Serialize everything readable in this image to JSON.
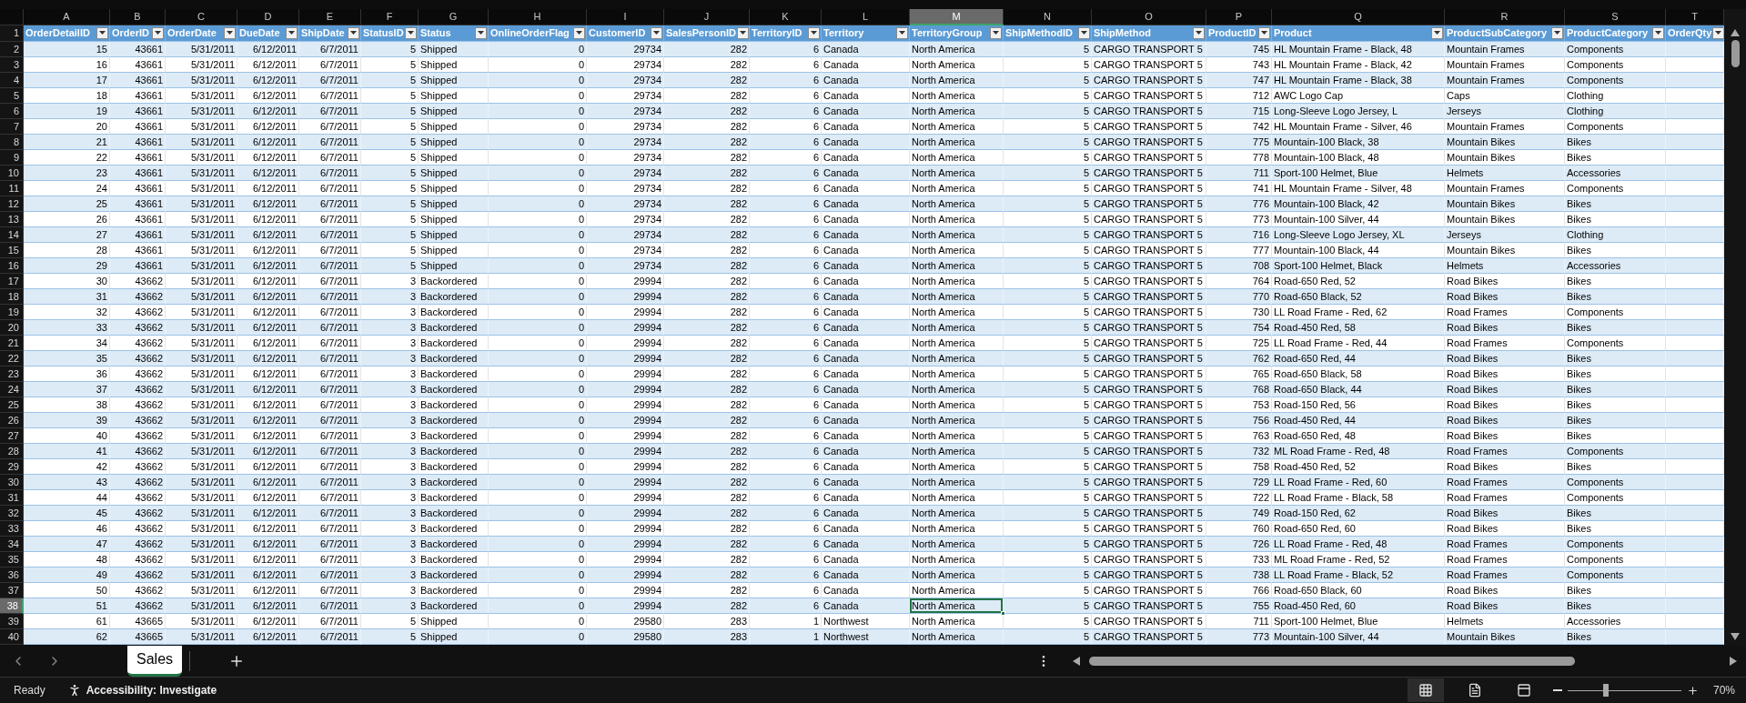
{
  "sheet": {
    "header_row_number": "1",
    "columns": [
      {
        "letter": "A",
        "header": "OrderDetailID",
        "kind": "number",
        "selected": false
      },
      {
        "letter": "B",
        "header": "OrderID",
        "kind": "number",
        "selected": false
      },
      {
        "letter": "C",
        "header": "OrderDate",
        "kind": "number",
        "selected": false
      },
      {
        "letter": "D",
        "header": "DueDate",
        "kind": "number",
        "selected": false
      },
      {
        "letter": "E",
        "header": "ShipDate",
        "kind": "number",
        "selected": false
      },
      {
        "letter": "F",
        "header": "StatusID",
        "kind": "number",
        "selected": false
      },
      {
        "letter": "G",
        "header": "Status",
        "kind": "text",
        "selected": false
      },
      {
        "letter": "H",
        "header": "OnlineOrderFlag",
        "kind": "number",
        "selected": false
      },
      {
        "letter": "I",
        "header": "CustomerID",
        "kind": "number",
        "selected": false
      },
      {
        "letter": "J",
        "header": "SalesPersonID",
        "kind": "number",
        "selected": false
      },
      {
        "letter": "K",
        "header": "TerritoryID",
        "kind": "number",
        "selected": false
      },
      {
        "letter": "L",
        "header": "Territory",
        "kind": "text",
        "selected": false
      },
      {
        "letter": "M",
        "header": "TerritoryGroup",
        "kind": "text",
        "selected": true
      },
      {
        "letter": "N",
        "header": "ShipMethodID",
        "kind": "number",
        "selected": false
      },
      {
        "letter": "O",
        "header": "ShipMethod",
        "kind": "text",
        "selected": false
      },
      {
        "letter": "P",
        "header": "ProductID",
        "kind": "number",
        "selected": false
      },
      {
        "letter": "Q",
        "header": "Product",
        "kind": "text",
        "selected": false
      },
      {
        "letter": "R",
        "header": "ProductSubCategory",
        "kind": "text",
        "selected": false
      },
      {
        "letter": "S",
        "header": "ProductCategory",
        "kind": "text",
        "selected": false
      },
      {
        "letter": "T",
        "header": "OrderQty",
        "kind": "number",
        "selected": false
      }
    ],
    "rows": [
      {
        "number": "2",
        "selected": false,
        "cells": [
          "15",
          "43661",
          "5/31/2011",
          "6/12/2011",
          "6/7/2011",
          "5",
          "Shipped",
          "0",
          "29734",
          "282",
          "6",
          "Canada",
          "North America",
          "5",
          "CARGO TRANSPORT 5",
          "745",
          "HL Mountain Frame - Black, 48",
          "Mountain Frames",
          "Components"
        ]
      },
      {
        "number": "3",
        "selected": false,
        "cells": [
          "16",
          "43661",
          "5/31/2011",
          "6/12/2011",
          "6/7/2011",
          "5",
          "Shipped",
          "0",
          "29734",
          "282",
          "6",
          "Canada",
          "North America",
          "5",
          "CARGO TRANSPORT 5",
          "743",
          "HL Mountain Frame - Black, 42",
          "Mountain Frames",
          "Components"
        ]
      },
      {
        "number": "4",
        "selected": false,
        "cells": [
          "17",
          "43661",
          "5/31/2011",
          "6/12/2011",
          "6/7/2011",
          "5",
          "Shipped",
          "0",
          "29734",
          "282",
          "6",
          "Canada",
          "North America",
          "5",
          "CARGO TRANSPORT 5",
          "747",
          "HL Mountain Frame - Black, 38",
          "Mountain Frames",
          "Components"
        ]
      },
      {
        "number": "5",
        "selected": false,
        "cells": [
          "18",
          "43661",
          "5/31/2011",
          "6/12/2011",
          "6/7/2011",
          "5",
          "Shipped",
          "0",
          "29734",
          "282",
          "6",
          "Canada",
          "North America",
          "5",
          "CARGO TRANSPORT 5",
          "712",
          "AWC Logo Cap",
          "Caps",
          "Clothing"
        ]
      },
      {
        "number": "6",
        "selected": false,
        "cells": [
          "19",
          "43661",
          "5/31/2011",
          "6/12/2011",
          "6/7/2011",
          "5",
          "Shipped",
          "0",
          "29734",
          "282",
          "6",
          "Canada",
          "North America",
          "5",
          "CARGO TRANSPORT 5",
          "715",
          "Long-Sleeve Logo Jersey, L",
          "Jerseys",
          "Clothing"
        ]
      },
      {
        "number": "7",
        "selected": false,
        "cells": [
          "20",
          "43661",
          "5/31/2011",
          "6/12/2011",
          "6/7/2011",
          "5",
          "Shipped",
          "0",
          "29734",
          "282",
          "6",
          "Canada",
          "North America",
          "5",
          "CARGO TRANSPORT 5",
          "742",
          "HL Mountain Frame - Silver, 46",
          "Mountain Frames",
          "Components"
        ]
      },
      {
        "number": "8",
        "selected": false,
        "cells": [
          "21",
          "43661",
          "5/31/2011",
          "6/12/2011",
          "6/7/2011",
          "5",
          "Shipped",
          "0",
          "29734",
          "282",
          "6",
          "Canada",
          "North America",
          "5",
          "CARGO TRANSPORT 5",
          "775",
          "Mountain-100 Black, 38",
          "Mountain Bikes",
          "Bikes"
        ]
      },
      {
        "number": "9",
        "selected": false,
        "cells": [
          "22",
          "43661",
          "5/31/2011",
          "6/12/2011",
          "6/7/2011",
          "5",
          "Shipped",
          "0",
          "29734",
          "282",
          "6",
          "Canada",
          "North America",
          "5",
          "CARGO TRANSPORT 5",
          "778",
          "Mountain-100 Black, 48",
          "Mountain Bikes",
          "Bikes"
        ]
      },
      {
        "number": "10",
        "selected": false,
        "cells": [
          "23",
          "43661",
          "5/31/2011",
          "6/12/2011",
          "6/7/2011",
          "5",
          "Shipped",
          "0",
          "29734",
          "282",
          "6",
          "Canada",
          "North America",
          "5",
          "CARGO TRANSPORT 5",
          "711",
          "Sport-100 Helmet, Blue",
          "Helmets",
          "Accessories"
        ]
      },
      {
        "number": "11",
        "selected": false,
        "cells": [
          "24",
          "43661",
          "5/31/2011",
          "6/12/2011",
          "6/7/2011",
          "5",
          "Shipped",
          "0",
          "29734",
          "282",
          "6",
          "Canada",
          "North America",
          "5",
          "CARGO TRANSPORT 5",
          "741",
          "HL Mountain Frame - Silver, 48",
          "Mountain Frames",
          "Components"
        ]
      },
      {
        "number": "12",
        "selected": false,
        "cells": [
          "25",
          "43661",
          "5/31/2011",
          "6/12/2011",
          "6/7/2011",
          "5",
          "Shipped",
          "0",
          "29734",
          "282",
          "6",
          "Canada",
          "North America",
          "5",
          "CARGO TRANSPORT 5",
          "776",
          "Mountain-100 Black, 42",
          "Mountain Bikes",
          "Bikes"
        ]
      },
      {
        "number": "13",
        "selected": false,
        "cells": [
          "26",
          "43661",
          "5/31/2011",
          "6/12/2011",
          "6/7/2011",
          "5",
          "Shipped",
          "0",
          "29734",
          "282",
          "6",
          "Canada",
          "North America",
          "5",
          "CARGO TRANSPORT 5",
          "773",
          "Mountain-100 Silver, 44",
          "Mountain Bikes",
          "Bikes"
        ]
      },
      {
        "number": "14",
        "selected": false,
        "cells": [
          "27",
          "43661",
          "5/31/2011",
          "6/12/2011",
          "6/7/2011",
          "5",
          "Shipped",
          "0",
          "29734",
          "282",
          "6",
          "Canada",
          "North America",
          "5",
          "CARGO TRANSPORT 5",
          "716",
          "Long-Sleeve Logo Jersey, XL",
          "Jerseys",
          "Clothing"
        ]
      },
      {
        "number": "15",
        "selected": false,
        "cells": [
          "28",
          "43661",
          "5/31/2011",
          "6/12/2011",
          "6/7/2011",
          "5",
          "Shipped",
          "0",
          "29734",
          "282",
          "6",
          "Canada",
          "North America",
          "5",
          "CARGO TRANSPORT 5",
          "777",
          "Mountain-100 Black, 44",
          "Mountain Bikes",
          "Bikes"
        ]
      },
      {
        "number": "16",
        "selected": false,
        "cells": [
          "29",
          "43661",
          "5/31/2011",
          "6/12/2011",
          "6/7/2011",
          "5",
          "Shipped",
          "0",
          "29734",
          "282",
          "6",
          "Canada",
          "North America",
          "5",
          "CARGO TRANSPORT 5",
          "708",
          "Sport-100 Helmet, Black",
          "Helmets",
          "Accessories"
        ]
      },
      {
        "number": "17",
        "selected": false,
        "cells": [
          "30",
          "43662",
          "5/31/2011",
          "6/12/2011",
          "6/7/2011",
          "3",
          "Backordered",
          "0",
          "29994",
          "282",
          "6",
          "Canada",
          "North America",
          "5",
          "CARGO TRANSPORT 5",
          "764",
          "Road-650 Red, 52",
          "Road Bikes",
          "Bikes"
        ]
      },
      {
        "number": "18",
        "selected": false,
        "cells": [
          "31",
          "43662",
          "5/31/2011",
          "6/12/2011",
          "6/7/2011",
          "3",
          "Backordered",
          "0",
          "29994",
          "282",
          "6",
          "Canada",
          "North America",
          "5",
          "CARGO TRANSPORT 5",
          "770",
          "Road-650 Black, 52",
          "Road Bikes",
          "Bikes"
        ]
      },
      {
        "number": "19",
        "selected": false,
        "cells": [
          "32",
          "43662",
          "5/31/2011",
          "6/12/2011",
          "6/7/2011",
          "3",
          "Backordered",
          "0",
          "29994",
          "282",
          "6",
          "Canada",
          "North America",
          "5",
          "CARGO TRANSPORT 5",
          "730",
          "LL Road Frame - Red, 62",
          "Road Frames",
          "Components"
        ]
      },
      {
        "number": "20",
        "selected": false,
        "cells": [
          "33",
          "43662",
          "5/31/2011",
          "6/12/2011",
          "6/7/2011",
          "3",
          "Backordered",
          "0",
          "29994",
          "282",
          "6",
          "Canada",
          "North America",
          "5",
          "CARGO TRANSPORT 5",
          "754",
          "Road-450 Red, 58",
          "Road Bikes",
          "Bikes"
        ]
      },
      {
        "number": "21",
        "selected": false,
        "cells": [
          "34",
          "43662",
          "5/31/2011",
          "6/12/2011",
          "6/7/2011",
          "3",
          "Backordered",
          "0",
          "29994",
          "282",
          "6",
          "Canada",
          "North America",
          "5",
          "CARGO TRANSPORT 5",
          "725",
          "LL Road Frame - Red, 44",
          "Road Frames",
          "Components"
        ]
      },
      {
        "number": "22",
        "selected": false,
        "cells": [
          "35",
          "43662",
          "5/31/2011",
          "6/12/2011",
          "6/7/2011",
          "3",
          "Backordered",
          "0",
          "29994",
          "282",
          "6",
          "Canada",
          "North America",
          "5",
          "CARGO TRANSPORT 5",
          "762",
          "Road-650 Red, 44",
          "Road Bikes",
          "Bikes"
        ]
      },
      {
        "number": "23",
        "selected": false,
        "cells": [
          "36",
          "43662",
          "5/31/2011",
          "6/12/2011",
          "6/7/2011",
          "3",
          "Backordered",
          "0",
          "29994",
          "282",
          "6",
          "Canada",
          "North America",
          "5",
          "CARGO TRANSPORT 5",
          "765",
          "Road-650 Black, 58",
          "Road Bikes",
          "Bikes"
        ]
      },
      {
        "number": "24",
        "selected": false,
        "cells": [
          "37",
          "43662",
          "5/31/2011",
          "6/12/2011",
          "6/7/2011",
          "3",
          "Backordered",
          "0",
          "29994",
          "282",
          "6",
          "Canada",
          "North America",
          "5",
          "CARGO TRANSPORT 5",
          "768",
          "Road-650 Black, 44",
          "Road Bikes",
          "Bikes"
        ]
      },
      {
        "number": "25",
        "selected": false,
        "cells": [
          "38",
          "43662",
          "5/31/2011",
          "6/12/2011",
          "6/7/2011",
          "3",
          "Backordered",
          "0",
          "29994",
          "282",
          "6",
          "Canada",
          "North America",
          "5",
          "CARGO TRANSPORT 5",
          "753",
          "Road-150 Red, 56",
          "Road Bikes",
          "Bikes"
        ]
      },
      {
        "number": "26",
        "selected": false,
        "cells": [
          "39",
          "43662",
          "5/31/2011",
          "6/12/2011",
          "6/7/2011",
          "3",
          "Backordered",
          "0",
          "29994",
          "282",
          "6",
          "Canada",
          "North America",
          "5",
          "CARGO TRANSPORT 5",
          "756",
          "Road-450 Red, 44",
          "Road Bikes",
          "Bikes"
        ]
      },
      {
        "number": "27",
        "selected": false,
        "cells": [
          "40",
          "43662",
          "5/31/2011",
          "6/12/2011",
          "6/7/2011",
          "3",
          "Backordered",
          "0",
          "29994",
          "282",
          "6",
          "Canada",
          "North America",
          "5",
          "CARGO TRANSPORT 5",
          "763",
          "Road-650 Red, 48",
          "Road Bikes",
          "Bikes"
        ]
      },
      {
        "number": "28",
        "selected": false,
        "cells": [
          "41",
          "43662",
          "5/31/2011",
          "6/12/2011",
          "6/7/2011",
          "3",
          "Backordered",
          "0",
          "29994",
          "282",
          "6",
          "Canada",
          "North America",
          "5",
          "CARGO TRANSPORT 5",
          "732",
          "ML Road Frame - Red, 48",
          "Road Frames",
          "Components"
        ]
      },
      {
        "number": "29",
        "selected": false,
        "cells": [
          "42",
          "43662",
          "5/31/2011",
          "6/12/2011",
          "6/7/2011",
          "3",
          "Backordered",
          "0",
          "29994",
          "282",
          "6",
          "Canada",
          "North America",
          "5",
          "CARGO TRANSPORT 5",
          "758",
          "Road-450 Red, 52",
          "Road Bikes",
          "Bikes"
        ]
      },
      {
        "number": "30",
        "selected": false,
        "cells": [
          "43",
          "43662",
          "5/31/2011",
          "6/12/2011",
          "6/7/2011",
          "3",
          "Backordered",
          "0",
          "29994",
          "282",
          "6",
          "Canada",
          "North America",
          "5",
          "CARGO TRANSPORT 5",
          "729",
          "LL Road Frame - Red, 60",
          "Road Frames",
          "Components"
        ]
      },
      {
        "number": "31",
        "selected": false,
        "cells": [
          "44",
          "43662",
          "5/31/2011",
          "6/12/2011",
          "6/7/2011",
          "3",
          "Backordered",
          "0",
          "29994",
          "282",
          "6",
          "Canada",
          "North America",
          "5",
          "CARGO TRANSPORT 5",
          "722",
          "LL Road Frame - Black, 58",
          "Road Frames",
          "Components"
        ]
      },
      {
        "number": "32",
        "selected": false,
        "cells": [
          "45",
          "43662",
          "5/31/2011",
          "6/12/2011",
          "6/7/2011",
          "3",
          "Backordered",
          "0",
          "29994",
          "282",
          "6",
          "Canada",
          "North America",
          "5",
          "CARGO TRANSPORT 5",
          "749",
          "Road-150 Red, 62",
          "Road Bikes",
          "Bikes"
        ]
      },
      {
        "number": "33",
        "selected": false,
        "cells": [
          "46",
          "43662",
          "5/31/2011",
          "6/12/2011",
          "6/7/2011",
          "3",
          "Backordered",
          "0",
          "29994",
          "282",
          "6",
          "Canada",
          "North America",
          "5",
          "CARGO TRANSPORT 5",
          "760",
          "Road-650 Red, 60",
          "Road Bikes",
          "Bikes"
        ]
      },
      {
        "number": "34",
        "selected": false,
        "cells": [
          "47",
          "43662",
          "5/31/2011",
          "6/12/2011",
          "6/7/2011",
          "3",
          "Backordered",
          "0",
          "29994",
          "282",
          "6",
          "Canada",
          "North America",
          "5",
          "CARGO TRANSPORT 5",
          "726",
          "LL Road Frame - Red, 48",
          "Road Frames",
          "Components"
        ]
      },
      {
        "number": "35",
        "selected": false,
        "cells": [
          "48",
          "43662",
          "5/31/2011",
          "6/12/2011",
          "6/7/2011",
          "3",
          "Backordered",
          "0",
          "29994",
          "282",
          "6",
          "Canada",
          "North America",
          "5",
          "CARGO TRANSPORT 5",
          "733",
          "ML Road Frame - Red, 52",
          "Road Frames",
          "Components"
        ]
      },
      {
        "number": "36",
        "selected": false,
        "cells": [
          "49",
          "43662",
          "5/31/2011",
          "6/12/2011",
          "6/7/2011",
          "3",
          "Backordered",
          "0",
          "29994",
          "282",
          "6",
          "Canada",
          "North America",
          "5",
          "CARGO TRANSPORT 5",
          "738",
          "LL Road Frame - Black, 52",
          "Road Frames",
          "Components"
        ]
      },
      {
        "number": "37",
        "selected": false,
        "cells": [
          "50",
          "43662",
          "5/31/2011",
          "6/12/2011",
          "6/7/2011",
          "3",
          "Backordered",
          "0",
          "29994",
          "282",
          "6",
          "Canada",
          "North America",
          "5",
          "CARGO TRANSPORT 5",
          "766",
          "Road-650 Black, 60",
          "Road Bikes",
          "Bikes"
        ]
      },
      {
        "number": "38",
        "selected": true,
        "cells": [
          "51",
          "43662",
          "5/31/2011",
          "6/12/2011",
          "6/7/2011",
          "3",
          "Backordered",
          "0",
          "29994",
          "282",
          "6",
          "Canada",
          "North America",
          "5",
          "CARGO TRANSPORT 5",
          "755",
          "Road-450 Red, 60",
          "Road Bikes",
          "Bikes"
        ]
      },
      {
        "number": "39",
        "selected": false,
        "cells": [
          "61",
          "43665",
          "5/31/2011",
          "6/12/2011",
          "6/7/2011",
          "5",
          "Shipped",
          "0",
          "29580",
          "283",
          "1",
          "Northwest",
          "North America",
          "5",
          "CARGO TRANSPORT 5",
          "711",
          "Sport-100 Helmet, Blue",
          "Helmets",
          "Accessories"
        ]
      },
      {
        "number": "40",
        "selected": false,
        "cells": [
          "62",
          "43665",
          "5/31/2011",
          "6/12/2011",
          "6/7/2011",
          "5",
          "Shipped",
          "0",
          "29580",
          "283",
          "1",
          "Northwest",
          "North America",
          "5",
          "CARGO TRANSPORT 5",
          "773",
          "Mountain-100 Silver, 44",
          "Mountain Bikes",
          "Bikes"
        ]
      }
    ]
  },
  "sheet_tabs": [
    {
      "label": "Sales",
      "selected": true
    }
  ],
  "status_bar": {
    "status": "Ready",
    "accessibility": "Accessibility: Investigate",
    "views": [
      {
        "kind": "normal",
        "selected": true
      },
      {
        "kind": "page_layout",
        "selected": false
      },
      {
        "kind": "page_break",
        "selected": false
      }
    ],
    "zoom": {
      "level": 0.34,
      "reading": "70%"
    }
  }
}
